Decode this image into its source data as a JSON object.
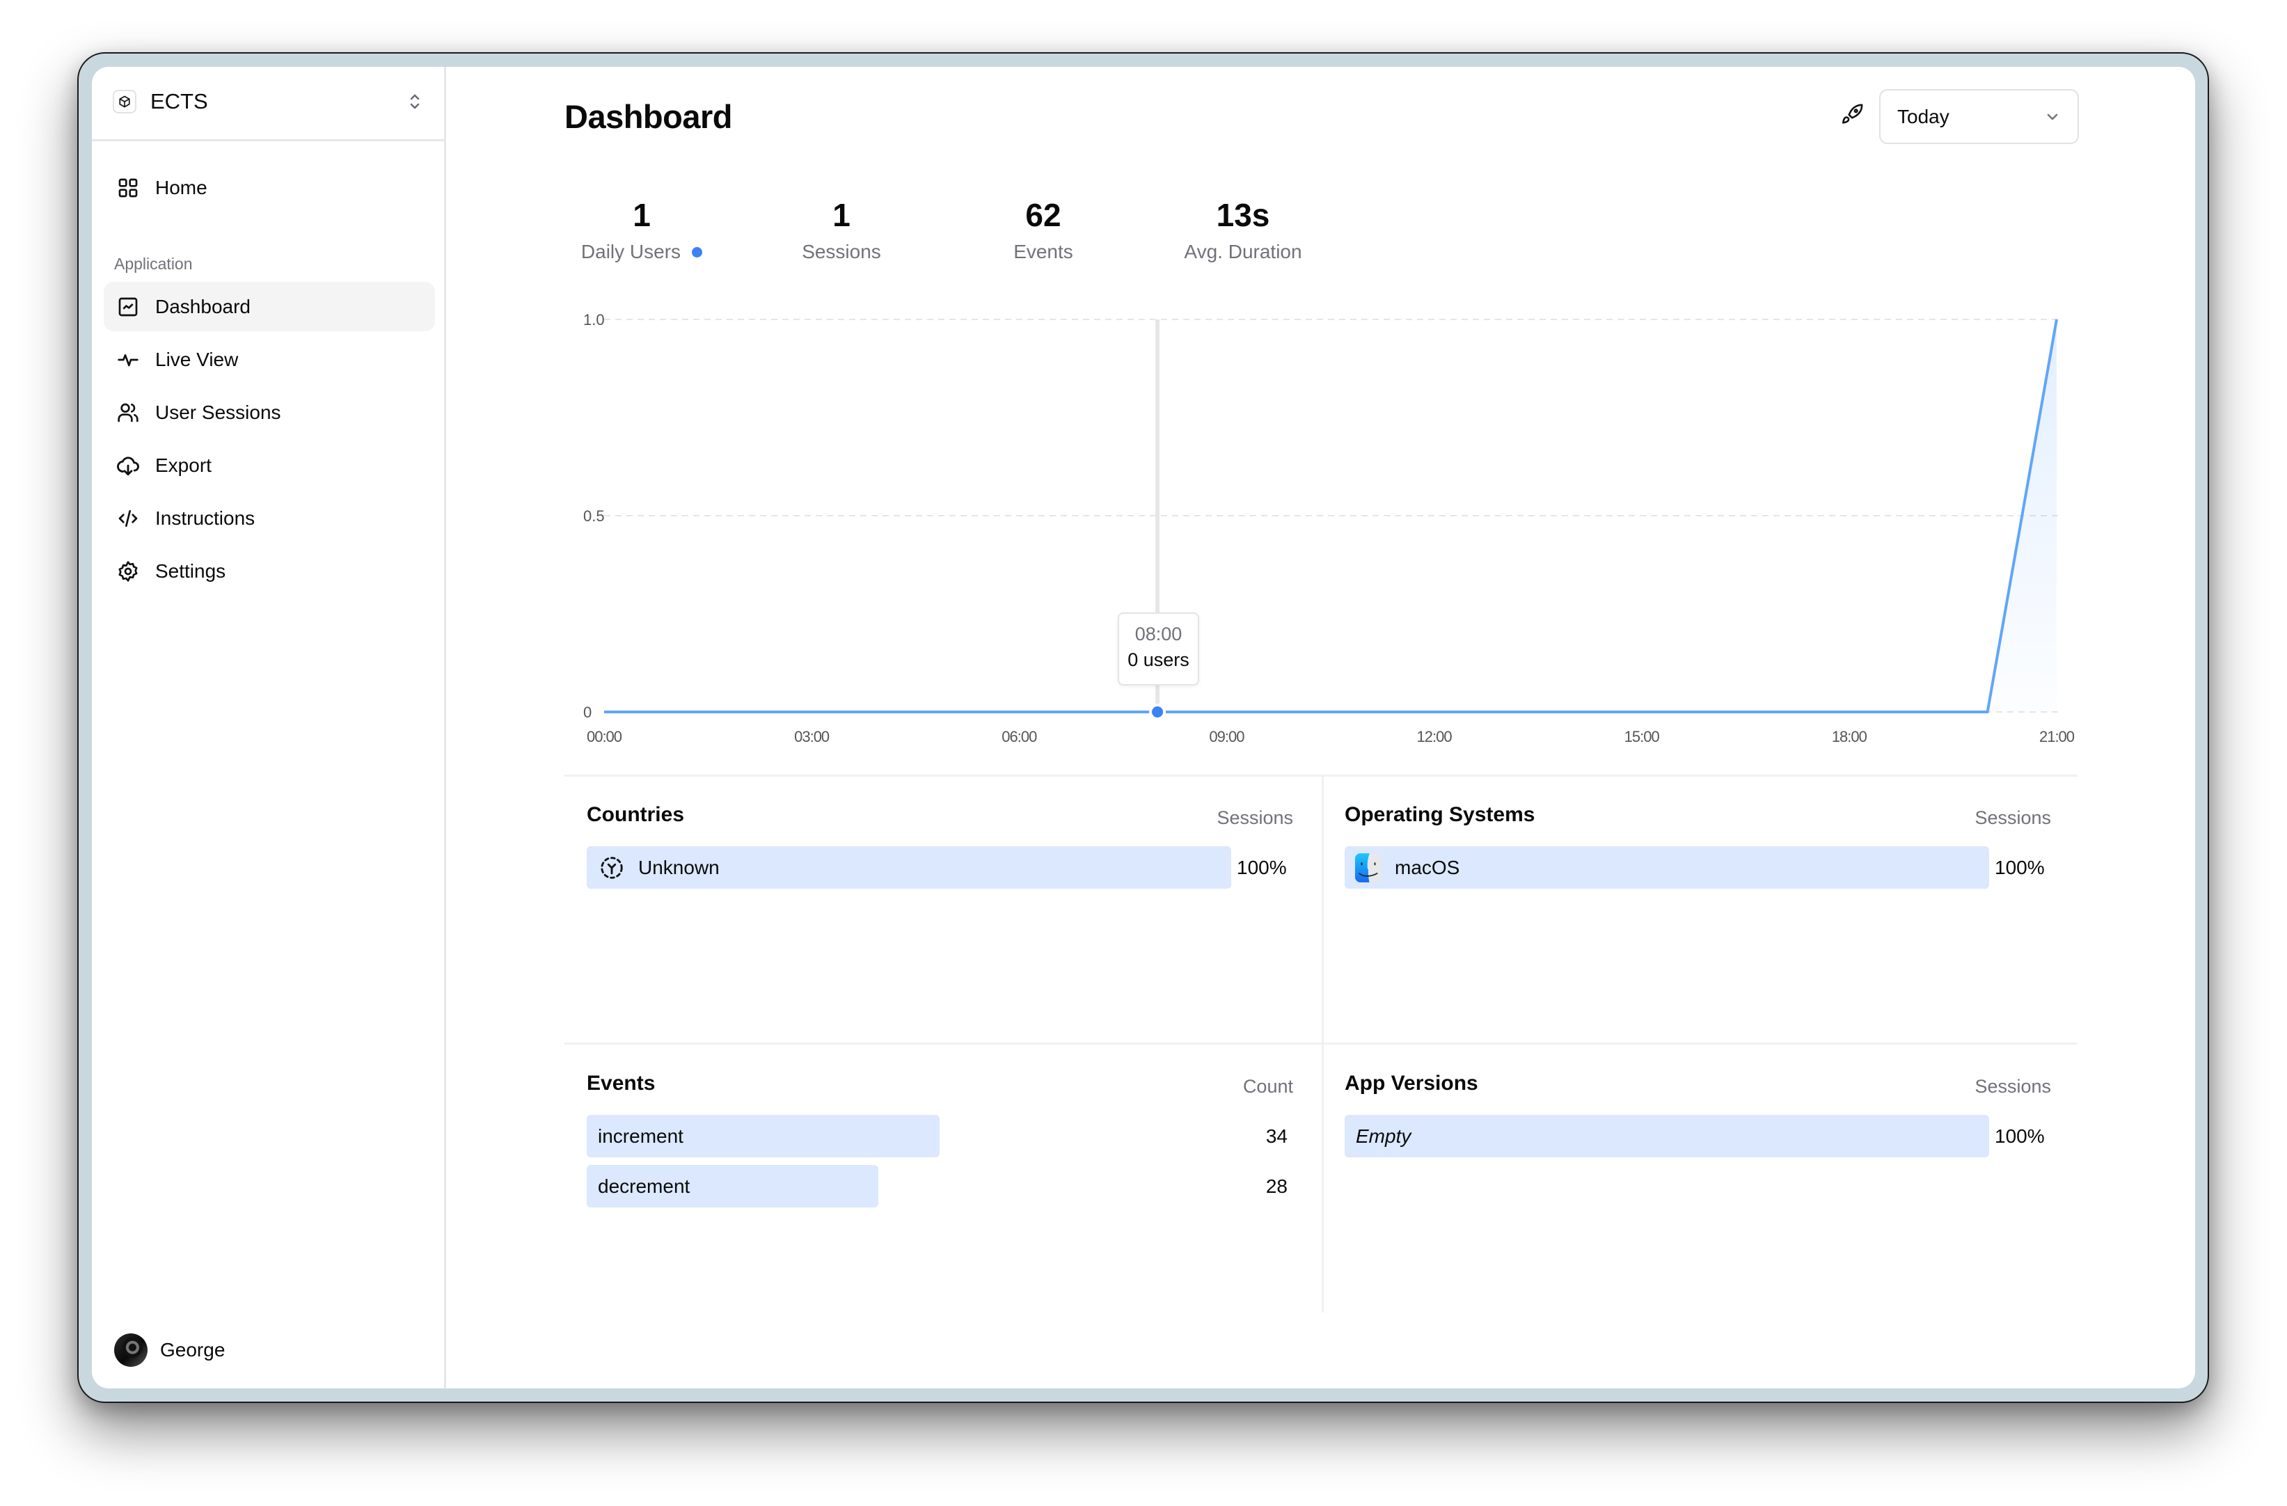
{
  "sidebar": {
    "team_name": "ECTS",
    "home_label": "Home",
    "group_label": "Application",
    "items": [
      {
        "label": "Dashboard",
        "icon": "chart-icon",
        "active": true
      },
      {
        "label": "Live View",
        "icon": "activity-icon",
        "active": false
      },
      {
        "label": "User Sessions",
        "icon": "users-icon",
        "active": false
      },
      {
        "label": "Export",
        "icon": "cloud-download-icon",
        "active": false
      },
      {
        "label": "Instructions",
        "icon": "code-icon",
        "active": false
      },
      {
        "label": "Settings",
        "icon": "gear-icon",
        "active": false
      }
    ],
    "user_name": "George"
  },
  "header": {
    "title": "Dashboard",
    "range_select": {
      "value": "Today"
    }
  },
  "stats": [
    {
      "value": "1",
      "label": "Daily Users"
    },
    {
      "value": "1",
      "label": "Sessions"
    },
    {
      "value": "62",
      "label": "Events"
    },
    {
      "value": "13s",
      "label": "Avg. Duration"
    }
  ],
  "colors": {
    "accent": "#3b82f6",
    "line": "#60a5fa",
    "bar": "#dbe8fd"
  },
  "chart_data": {
    "type": "area",
    "title": "",
    "xlabel": "",
    "ylabel": "",
    "x": [
      "00:00",
      "01:00",
      "02:00",
      "03:00",
      "04:00",
      "05:00",
      "06:00",
      "07:00",
      "08:00",
      "09:00",
      "10:00",
      "11:00",
      "12:00",
      "13:00",
      "14:00",
      "15:00",
      "16:00",
      "17:00",
      "18:00",
      "19:00",
      "20:00",
      "21:00"
    ],
    "series": [
      {
        "name": "Daily Users",
        "values": [
          0,
          0,
          0,
          0,
          0,
          0,
          0,
          0,
          0,
          0,
          0,
          0,
          0,
          0,
          0,
          0,
          0,
          0,
          0,
          0,
          0,
          1
        ]
      }
    ],
    "x_tick_labels": [
      "00:00",
      "03:00",
      "06:00",
      "09:00",
      "12:00",
      "15:00",
      "18:00",
      "21:00"
    ],
    "y_tick_labels": [
      "0",
      "0.5",
      "1.0"
    ],
    "y_ticks": [
      0,
      0.5,
      1.0
    ],
    "ylim": [
      0,
      1
    ],
    "grid": true,
    "tooltip": {
      "time": "08:00",
      "value_text": "0 users",
      "index": 8
    }
  },
  "panels": {
    "countries": {
      "title": "Countries",
      "column": "Sessions",
      "rows": [
        {
          "label": "Unknown",
          "value": "100%",
          "fraction": 1.0,
          "icon": "unknown-location-icon"
        }
      ]
    },
    "operating_systems": {
      "title": "Operating Systems",
      "column": "Sessions",
      "rows": [
        {
          "label": "macOS",
          "value": "100%",
          "fraction": 1.0,
          "icon": "finder-icon"
        }
      ]
    },
    "events": {
      "title": "Events",
      "column": "Count",
      "rows": [
        {
          "label": "increment",
          "value": "34",
          "fraction": 0.548
        },
        {
          "label": "decrement",
          "value": "28",
          "fraction": 0.452
        }
      ]
    },
    "app_versions": {
      "title": "App Versions",
      "column": "Sessions",
      "rows": [
        {
          "label": "Empty",
          "value": "100%",
          "fraction": 1.0
        }
      ]
    }
  }
}
